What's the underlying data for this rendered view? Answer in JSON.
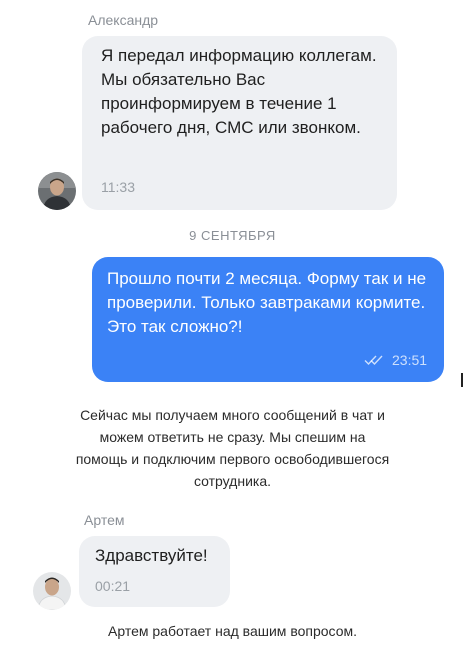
{
  "messages": [
    {
      "sender": "Александр",
      "text": "Я передал информацию коллегам. Мы обязательно Вас проинформируем в течение 1 рабочего дня, СМС или звонком.",
      "time": "11:33"
    },
    {
      "date_separator": "9 СЕНТЯБРЯ"
    },
    {
      "text": "Прошло почти 2 месяца. Форму так и не проверили. Только завтраками кормите. Это так сложно?!",
      "time": "23:51",
      "status_icon": "double-check-icon"
    },
    {
      "system_notice": "Сейчас мы получаем много сообщений в чат и можем ответить не сразу. Мы спешим на помощь и подключим первого освободившегося сотрудника."
    },
    {
      "sender": "Артем",
      "text": "Здравствуйте!",
      "time": "00:21"
    },
    {
      "system_notice": "Артем работает над вашим вопросом."
    }
  ],
  "colors": {
    "outgoing_bubble": "#3b82f6",
    "incoming_bubble": "#eef0f3"
  }
}
